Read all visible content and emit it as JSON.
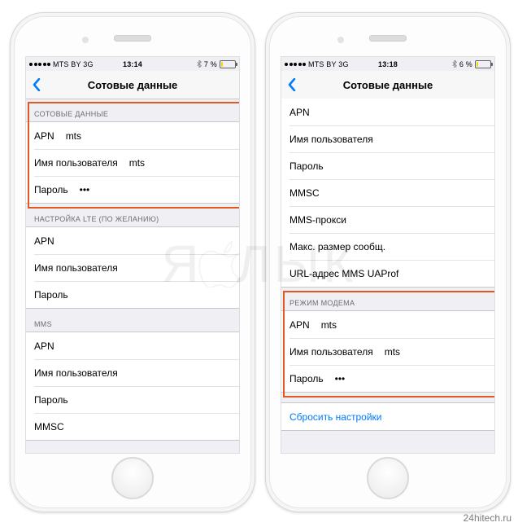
{
  "watermark": "ЯБЛЫК",
  "credit": "24hitech.ru",
  "phones": [
    {
      "status": {
        "carrier": "MTS BY  3G",
        "time": "13:14",
        "battery_pct": 7,
        "battery_label": "7 %"
      },
      "nav": {
        "title": "Сотовые данные"
      },
      "highlight_box": 0,
      "sections": [
        {
          "header": "СОТОВЫЕ ДАННЫЕ",
          "rows": [
            {
              "label": "APN",
              "value": "mts"
            },
            {
              "label": "Имя пользователя",
              "value": "mts"
            },
            {
              "label": "Пароль",
              "value": "•••"
            }
          ]
        },
        {
          "header": "НАСТРОЙКА LTE (ПО ЖЕЛАНИЮ)",
          "rows": [
            {
              "label": "APN",
              "value": ""
            },
            {
              "label": "Имя пользователя",
              "value": ""
            },
            {
              "label": "Пароль",
              "value": ""
            }
          ]
        },
        {
          "header": "MMS",
          "rows": [
            {
              "label": "APN",
              "value": ""
            },
            {
              "label": "Имя пользователя",
              "value": ""
            },
            {
              "label": "Пароль",
              "value": ""
            },
            {
              "label": "MMSC",
              "value": ""
            }
          ]
        }
      ]
    },
    {
      "status": {
        "carrier": "MTS BY  3G",
        "time": "13:18",
        "battery_pct": 6,
        "battery_label": "6 %"
      },
      "nav": {
        "title": "Сотовые данные"
      },
      "highlight_box": 1,
      "sections": [
        {
          "header": "",
          "rows": [
            {
              "label": "APN",
              "value": ""
            },
            {
              "label": "Имя пользователя",
              "value": ""
            },
            {
              "label": "Пароль",
              "value": ""
            },
            {
              "label": "MMSC",
              "value": ""
            },
            {
              "label": "MMS-прокси",
              "value": ""
            },
            {
              "label": "Макс. размер сообщ.",
              "value": ""
            },
            {
              "label": "URL-адрес MMS UAProf",
              "value": ""
            }
          ]
        },
        {
          "header": "РЕЖИМ МОДЕМА",
          "rows": [
            {
              "label": "APN",
              "value": "mts"
            },
            {
              "label": "Имя пользователя",
              "value": "mts"
            },
            {
              "label": "Пароль",
              "value": "•••"
            }
          ]
        }
      ],
      "footer_link": "Сбросить настройки"
    }
  ]
}
